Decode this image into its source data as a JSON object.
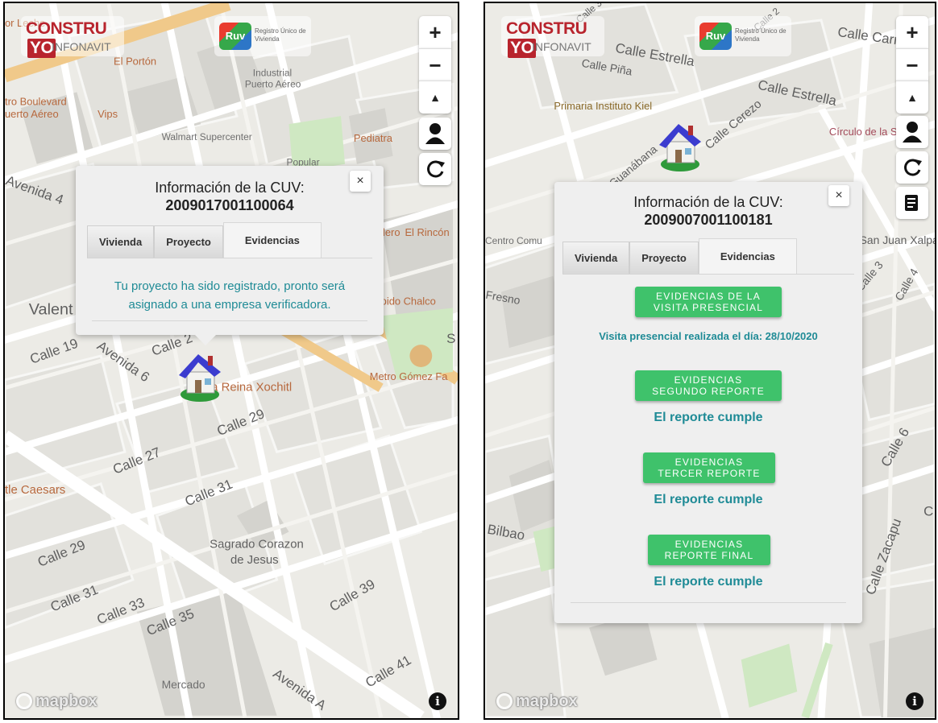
{
  "left_screen": {
    "logos": {
      "construyo_main": "CONSTRU",
      "construyo_yo": "YO",
      "construyo_sub": "INFONAVIT",
      "ruv_badge": "Ruv",
      "ruv_text": "Registro Único de Vivienda"
    },
    "controls": {
      "zoom_in": "+",
      "zoom_out": "−",
      "compass": "▲",
      "info": "i"
    },
    "attribution": "mapbox",
    "map_labels": {
      "poi_elporton": "El Portón",
      "poi_industrial": "Industrial",
      "poi_puerto": "Puerto Aéreo",
      "poi_boulevard": "tro Boulevard",
      "poi_puertoaereo": "uerto Aéreo",
      "poi_vips": "Vips",
      "poi_walmart": "Walmart Supercenter",
      "poi_pediatra": "Pediatra",
      "poi_popular": "Popular",
      "poi_lecre": "or Leche",
      "avenida4": "Avenida 4",
      "valent": "Valent",
      "calle19": "Calle 19",
      "avenida6": "Avenida 6",
      "calle2x": "Calle 2",
      "reina": "a Reina Xochitl",
      "calle29a": "Calle 29",
      "calle27": "Calle 27",
      "calle31a": "Calle 31",
      "caesars": "tle Caesars",
      "calle29b": "Calle 29",
      "calle31b": "Calle 31",
      "calle33": "Calle 33",
      "calle35": "Calle 35",
      "sagrado1": "Sagrado Corazon",
      "sagrado2": "de Jesus",
      "calle39": "Calle 39",
      "calle41": "Calle 41",
      "mercado": "Mercado",
      "avenidaa": "Avenida A",
      "elrincon": "El Rincón",
      "dero": "dero",
      "pido": "pido Chalco",
      "metro": "Metro Gómez Fa",
      "s": "S"
    },
    "popup": {
      "title_line1": "Información de la CUV:",
      "title_line2": "2009017001100064",
      "close": "×",
      "tabs": [
        "Vivienda",
        "Proyecto",
        "Evidencias"
      ],
      "message_line1": "Tu proyecto ha sido registrado, pronto será",
      "message_line2": "asignado a una empresa verificadora."
    }
  },
  "right_screen": {
    "logos": {
      "construyo_main": "CONSTRU",
      "construyo_yo": "YO",
      "construyo_sub": "INFONAVIT",
      "ruv_badge": "Ruv",
      "ruv_text": "Registro Único de Vivienda"
    },
    "controls": {
      "zoom_in": "+",
      "zoom_out": "−",
      "compass": "▲",
      "info": "i"
    },
    "attribution": "mapbox",
    "map_labels": {
      "calle3": "Calle 3",
      "calle2": "Calle 2",
      "callecarr": "Calle Carri",
      "calleestrella1": "Calle Estrella",
      "callepina": "Calle Piña",
      "calleestrella2": "Calle Estrella",
      "primaria": "Primaria Instituto Kiel",
      "callecerezo": "Calle Cerezo",
      "circulo": "Círculo de la S",
      "guanabana": "Guanábana",
      "centro": "Centro Comu",
      "sanjuan": "San Juan Xalpa",
      "fresno": "Fresno",
      "calle3b": "Calle 3",
      "calle4": "Calle 4",
      "calle6": "Calle 6",
      "bilbao": "Bilbao",
      "zacapu": "Calle Zacapu",
      "c": "C"
    },
    "popup": {
      "title_line1": "Información de la CUV:",
      "title_line2": "2009007001100181",
      "close": "×",
      "tabs": [
        "Vivienda",
        "Proyecto",
        "Evidencias"
      ],
      "buttons": [
        {
          "line1": "EVIDENCIAS DE LA",
          "line2": "VISITA PRESENCIAL",
          "status": "Visita presencial realizada el día: 28/10/2020"
        },
        {
          "line1": "EVIDENCIAS",
          "line2": "SEGUNDO REPORTE",
          "status": "El reporte cumple"
        },
        {
          "line1": "EVIDENCIAS",
          "line2": "TERCER REPORTE",
          "status": "El reporte cumple"
        },
        {
          "line1": "EVIDENCIAS",
          "line2": "REPORTE FINAL",
          "status": "El reporte cumple"
        }
      ]
    }
  },
  "colors": {
    "accent_green": "#3fc26b",
    "status_teal": "#1f8b96",
    "road_orange": "#f0c98a",
    "park_green": "#cfe8c2"
  }
}
